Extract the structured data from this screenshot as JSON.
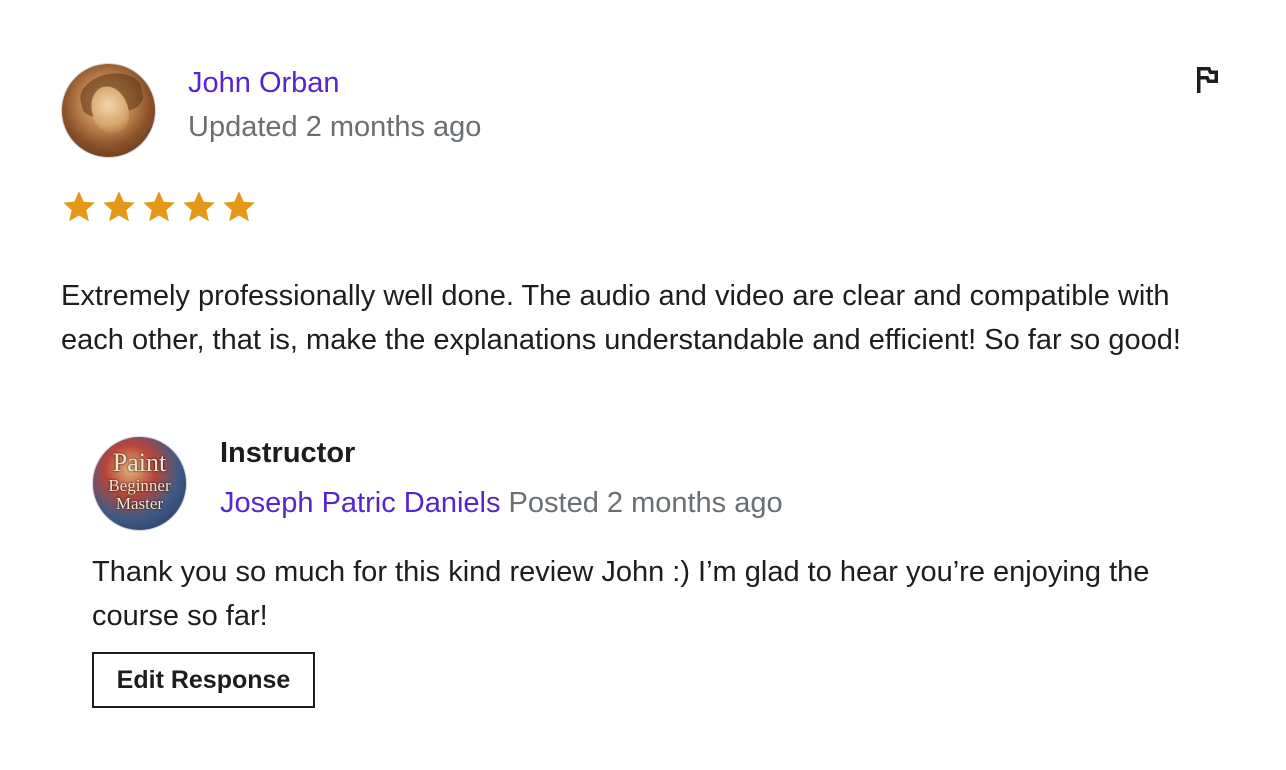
{
  "review": {
    "reviewer": {
      "name": "John Orban",
      "meta": "Updated 2 months ago",
      "avatar_icon": "portrait-painting-avatar"
    },
    "rating": 5,
    "rating_max": 5,
    "star_color": "#e59819",
    "comment": "Extremely professionally well done. The audio and video are clear and compatible with each other, that is, make the explanations understandable and efficient! So far so good!",
    "report_icon": "flag-icon"
  },
  "response": {
    "label": "Instructor",
    "instructor_name": "Joseph Patric Daniels",
    "meta": "Posted 2 months ago",
    "avatar_text": {
      "line1": "Paint",
      "line2": "Beginner",
      "line3": "Master"
    },
    "text": "Thank you so much for this kind review John :) I’m glad to hear you’re enjoying the course so far!",
    "edit_button_label": "Edit Response"
  },
  "colors": {
    "link": "#5624d0",
    "muted": "#6a6f73",
    "text": "#1c1d1f"
  }
}
